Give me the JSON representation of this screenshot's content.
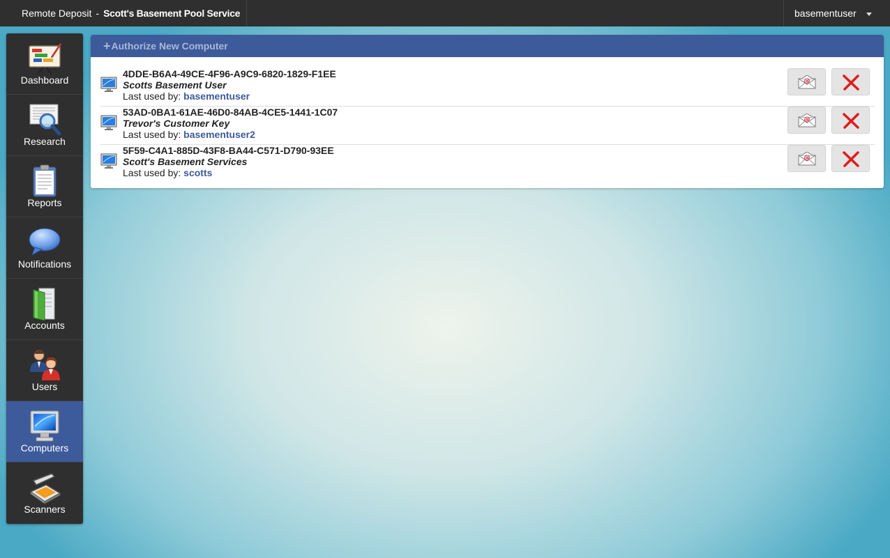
{
  "header": {
    "app_name": "Remote Deposit",
    "separator": "-",
    "company": "Scott's Basement Pool Service",
    "user": "basementuser"
  },
  "sidebar": {
    "items": [
      {
        "label": "Dashboard",
        "icon": "dashboard-icon"
      },
      {
        "label": "Research",
        "icon": "research-icon"
      },
      {
        "label": "Reports",
        "icon": "reports-icon"
      },
      {
        "label": "Notifications",
        "icon": "notifications-icon"
      },
      {
        "label": "Accounts",
        "icon": "accounts-icon"
      },
      {
        "label": "Users",
        "icon": "users-icon"
      },
      {
        "label": "Computers",
        "icon": "computers-icon",
        "active": true
      },
      {
        "label": "Scanners",
        "icon": "scanners-icon"
      }
    ]
  },
  "panel": {
    "header_plus": "+",
    "header_label": "Authorize New Computer",
    "last_used_label": "Last used by:",
    "computers": [
      {
        "key": "4DDE-B6A4-49CE-4F96-A9C9-6820-1829-F1EE",
        "description": "Scotts Basement User",
        "last_used_by": "basementuser"
      },
      {
        "key": "53AD-0BA1-61AE-46D0-84AB-4CE5-1441-1C07",
        "description": "Trevor's Customer Key",
        "last_used_by": "basementuser2"
      },
      {
        "key": "5F59-C4A1-885D-43F8-BA44-C571-D790-93EE",
        "description": "Scott's Basement Services",
        "last_used_by": "scotts"
      }
    ]
  },
  "colors": {
    "accent": "#3d5a9a",
    "topbar": "#2f2f2f",
    "delete_red": "#e01b1b"
  }
}
